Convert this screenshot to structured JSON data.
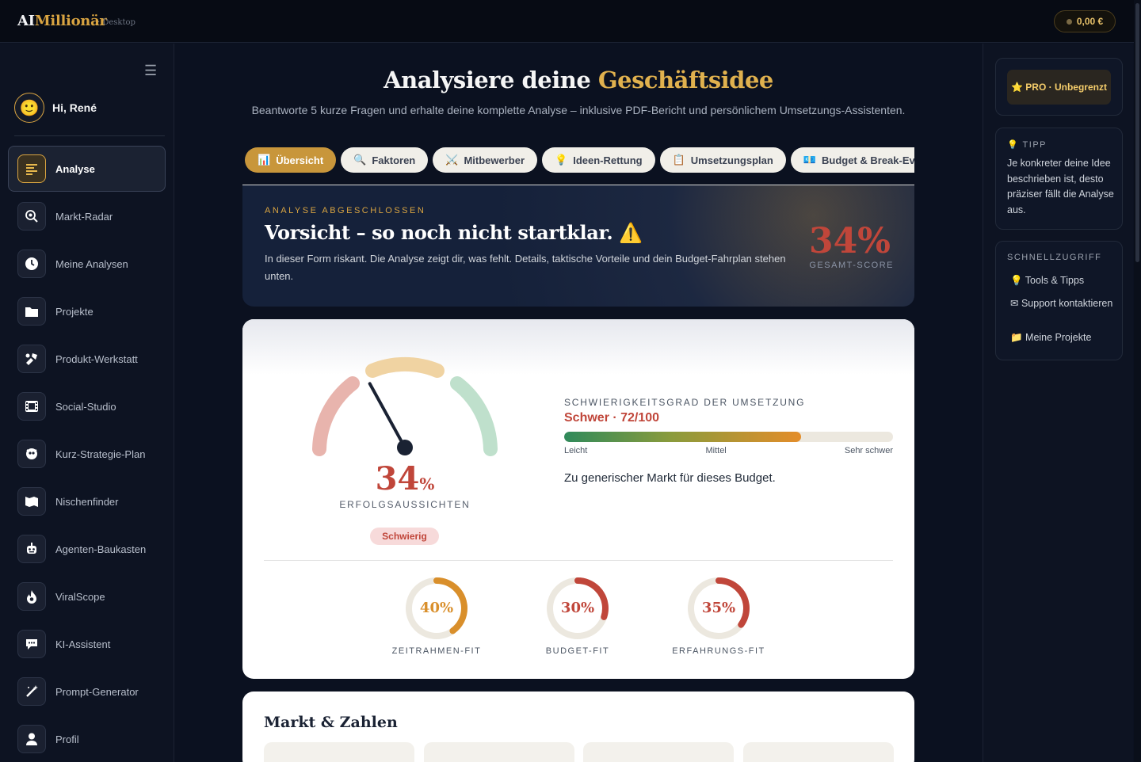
{
  "app": {
    "logo_ai": "AI",
    "logo_name": "Millionär",
    "logo_sub": "· Desktop",
    "balance": "0,00 €"
  },
  "sidebar": {
    "greeting": "Hi, René",
    "avatar_emoji": "🙂",
    "items": [
      {
        "label": "Analyse",
        "icon": "analysis-icon",
        "active": true
      },
      {
        "label": "Markt-Radar",
        "icon": "radar-search-icon"
      },
      {
        "label": "Meine Analysen",
        "icon": "clock-icon"
      },
      {
        "label": "Projekte",
        "icon": "folder-icon"
      },
      {
        "label": "Produkt-Werkstatt",
        "icon": "tools-icon"
      },
      {
        "label": "Social-Studio",
        "icon": "film-icon"
      },
      {
        "label": "Kurz-Strategie-Plan",
        "icon": "target-icon"
      },
      {
        "label": "Nischenfinder",
        "icon": "map-icon"
      },
      {
        "label": "Agenten-Baukasten",
        "icon": "robot-icon"
      },
      {
        "label": "ViralScope",
        "icon": "fire-icon"
      },
      {
        "label": "KI-Assistent",
        "icon": "chat-icon"
      },
      {
        "label": "Prompt-Generator",
        "icon": "magic-wand-icon"
      },
      {
        "label": "Profil",
        "icon": "user-icon"
      }
    ]
  },
  "main": {
    "title_plain": "Analysiere deine ",
    "title_accent": "Geschäftsidee",
    "subtitle": "Beantworte 5 kurze Fragen und erhalte deine komplette Analyse – inklusive PDF-Bericht und persönlichem Umsetzungs-Assistenten.",
    "tabs": [
      {
        "emoji": "📊",
        "label": "Übersicht",
        "active": true
      },
      {
        "emoji": "🔍",
        "label": "Faktoren"
      },
      {
        "emoji": "⚔️",
        "label": "Mitbewerber"
      },
      {
        "emoji": "💡",
        "label": "Ideen-Rettung"
      },
      {
        "emoji": "📋",
        "label": "Umsetzungsplan"
      },
      {
        "emoji": "💶",
        "label": "Budget & Break-Even"
      }
    ]
  },
  "banner": {
    "kicker": "ANALYSE ABGESCHLOSSEN",
    "title": "Vorsicht – so noch nicht startklar. ⚠️",
    "text": "In dieser Form riskant. Die Analyse zeigt dir, was fehlt. Details, taktische Vorteile und dein Budget-Fahrplan stehen unten.",
    "score": "34%",
    "score_label": "GESAMT-SCORE"
  },
  "overview": {
    "gauge_value": 34,
    "gauge_value_text": "34",
    "gauge_unit": "%",
    "gauge_label": "ERFOLGSAUSSICHTEN",
    "badge": "Schwierig",
    "difficulty_kicker": "SCHWIERIGKEITSGRAD DER UMSETZUNG",
    "difficulty_value": "Schwer · 72/100",
    "difficulty_score": 72,
    "scale": [
      "Leicht",
      "Mittel",
      "Sehr schwer"
    ],
    "note": "Zu generischer Markt für dieses Budget.",
    "fits": [
      {
        "label": "ZEITRAHMEN-FIT",
        "value": 40,
        "text": "40%",
        "color": "#d98f2b"
      },
      {
        "label": "BUDGET-FIT",
        "value": 30,
        "text": "30%",
        "color": "#c0463a"
      },
      {
        "label": "ERFAHRUNGS-FIT",
        "value": 35,
        "text": "35%",
        "color": "#c0463a"
      }
    ]
  },
  "market": {
    "title": "Markt & Zahlen"
  },
  "right": {
    "pro_label": "⭐ PRO · Unbegrenzt",
    "tip_kicker": "💡 TIPP",
    "tip_text": "Je konkreter deine Idee beschrieben ist, desto präziser fällt die Analyse aus.",
    "quick_kicker": "SCHNELLZUGRIFF",
    "quick_links": [
      "💡 Tools & Tipps",
      "✉ Support kontaktieren",
      "📁 Meine Projekte"
    ]
  }
}
